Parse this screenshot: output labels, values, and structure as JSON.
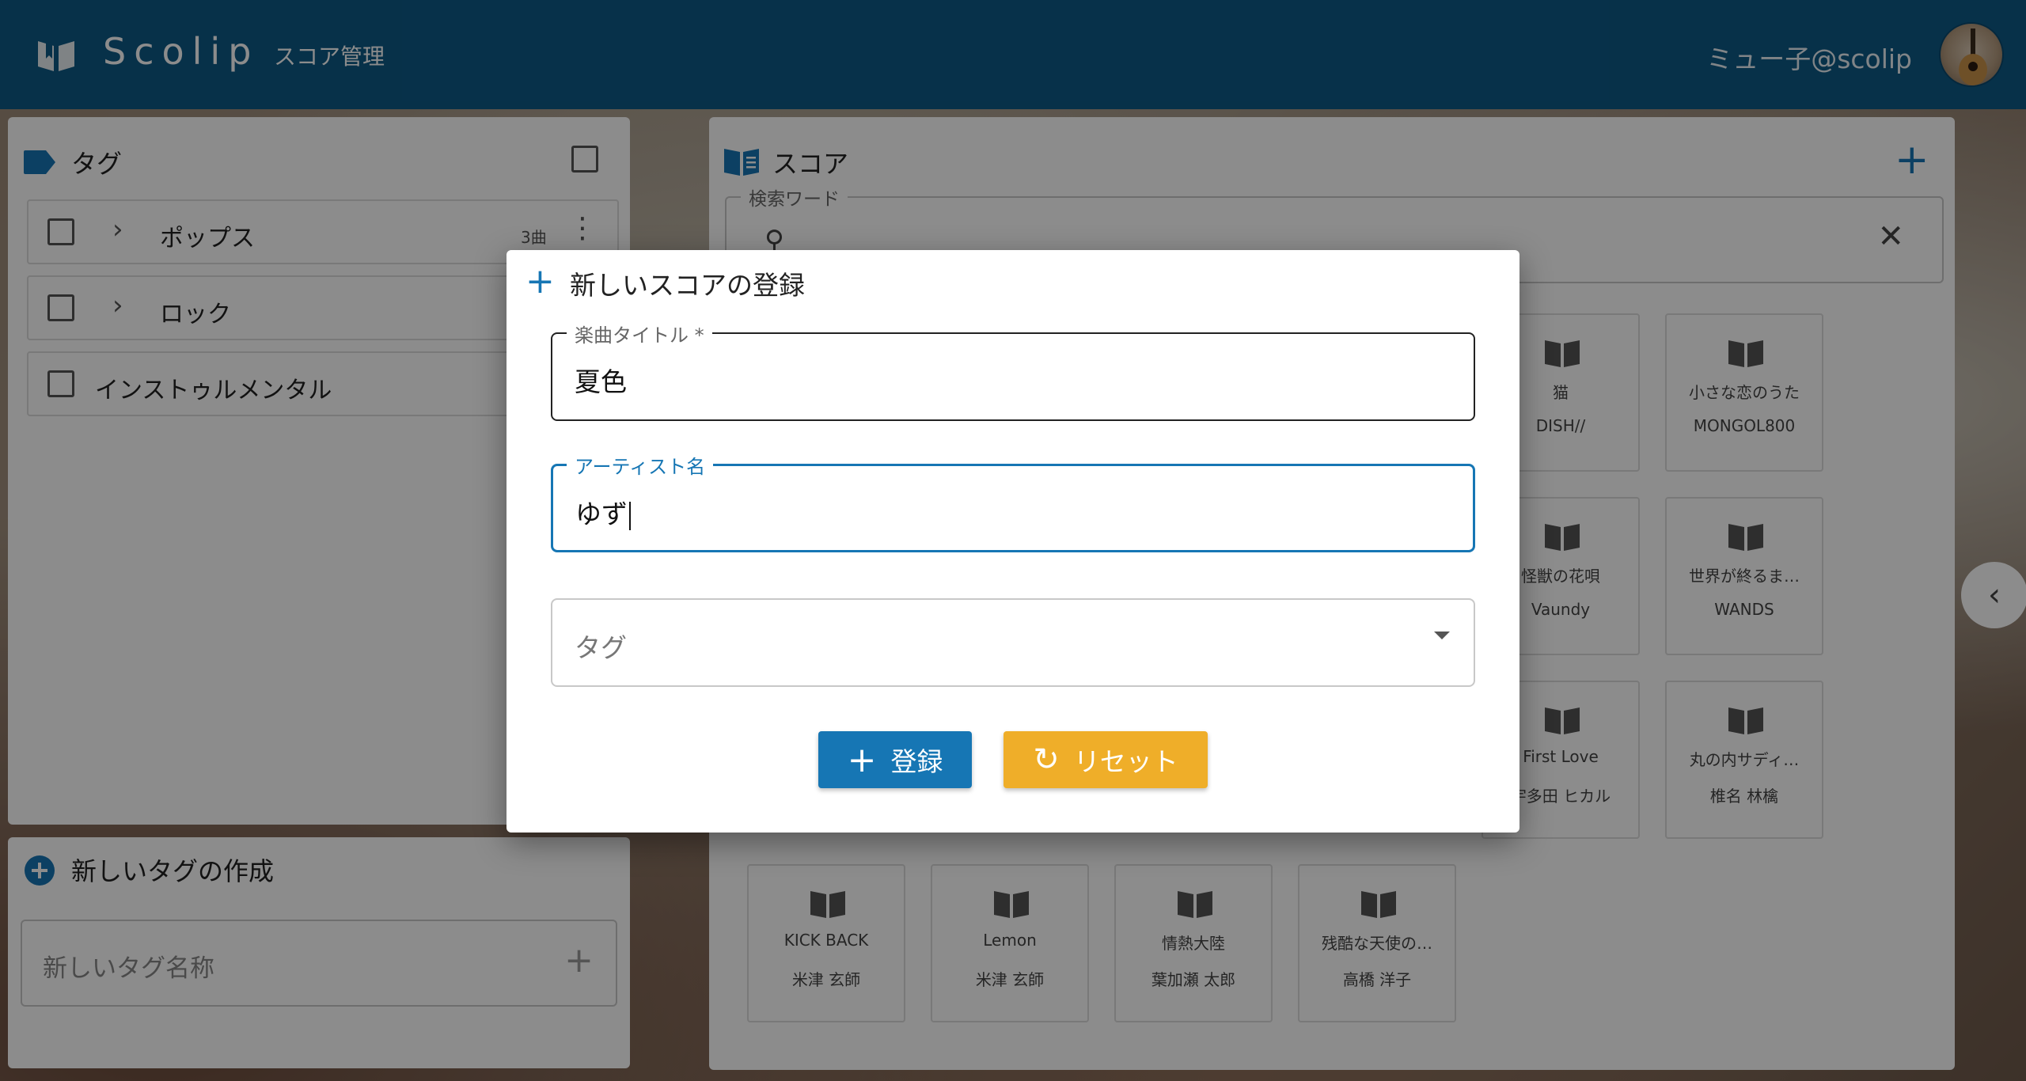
{
  "appbar": {
    "brand": "Scolip",
    "nav": "スコア管理",
    "user": "ミュー子@scolip",
    "logo_icon": "book-open-icon",
    "avatar_icon": "guitar-avatar"
  },
  "tag_panel": {
    "title": "タグ",
    "items": [
      {
        "label": "ポップス",
        "count": "3曲",
        "expandable": true
      },
      {
        "label": "ロック",
        "expandable": true
      },
      {
        "label": "インストゥルメンタル",
        "expandable": false
      }
    ]
  },
  "new_tag_panel": {
    "title": "新しいタグの作成",
    "placeholder": "新しいタグ名称"
  },
  "score_panel": {
    "title": "スコア",
    "search_legend": "検索ワード",
    "cards": [
      {
        "title": "猫",
        "artist": "DISH//"
      },
      {
        "title": "小さな恋のうた",
        "artist": "MONGOL800"
      },
      {
        "title": "怪獣の花唄",
        "artist": "Vaundy"
      },
      {
        "title": "世界が終るま…",
        "artist": "WANDS"
      },
      {
        "title": "First Love",
        "artist": "宇多田 ヒカル"
      },
      {
        "title": "丸の内サディ…",
        "artist": "椎名 林檎"
      },
      {
        "title": "KICK BACK",
        "artist": "米津 玄師"
      },
      {
        "title": "Lemon",
        "artist": "米津 玄師"
      },
      {
        "title": "情熱大陸",
        "artist": "葉加瀬 太郎"
      },
      {
        "title": "残酷な天使の…",
        "artist": "高橋 洋子"
      }
    ]
  },
  "dialog": {
    "title": "新しいスコアの登録",
    "song_title_label": "楽曲タイトル *",
    "song_title_value": "夏色",
    "artist_label": "アーティスト名",
    "artist_value": "ゆず",
    "tag_placeholder": "タグ",
    "register_label": "登録",
    "reset_label": "リセット"
  },
  "colors": {
    "primary": "#1676b4",
    "appbar": "#0d5a86",
    "reset": "#efae29"
  }
}
